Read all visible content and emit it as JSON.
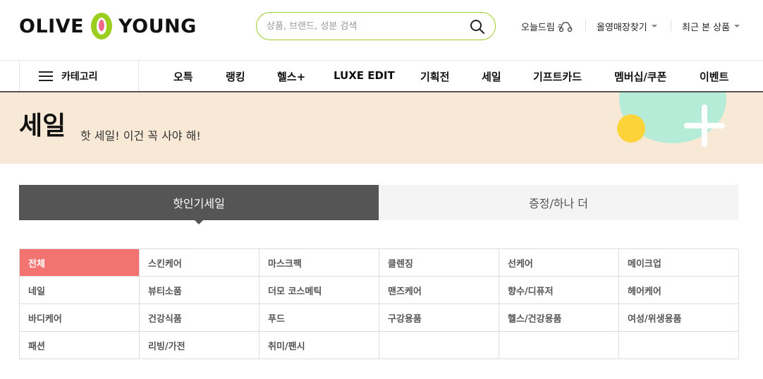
{
  "header": {
    "logo": {
      "left": "OLIVE",
      "right": "YOUNG"
    },
    "search": {
      "placeholder": "상품, 브랜드, 성분 검색",
      "value": ""
    },
    "utils": {
      "dream": "오늘드림",
      "store": "올영매장찾기",
      "recent": "최근 본 상품"
    }
  },
  "gnb": {
    "category_label": "카테고리",
    "items": [
      "오특",
      "랭킹",
      "헬스+",
      "LUXE EDIT",
      "기획전",
      "세일",
      "기프트카드",
      "멤버십/쿠폰",
      "이벤트"
    ]
  },
  "banner": {
    "title": "세일",
    "subtitle": "핫 세일! 이건 꼭 사야 해!"
  },
  "tabs": {
    "hot": "핫인기세일",
    "gift": "증정/하나 더"
  },
  "categories": [
    "전체",
    "스킨케어",
    "마스크팩",
    "클렌징",
    "선케어",
    "메이크업",
    "네일",
    "뷰티소품",
    "더모 코스메틱",
    "맨즈케어",
    "향수/디퓨저",
    "헤어케어",
    "바디케어",
    "건강식품",
    "푸드",
    "구강용품",
    "헬스/건강용품",
    "여성/위생용품",
    "패션",
    "리빙/가전",
    "취미/팬시"
  ],
  "colors": {
    "brand_green": "#9bce26",
    "active_category": "#f27370",
    "tab_active": "#555555",
    "banner_bg": "#f8e8d6"
  }
}
